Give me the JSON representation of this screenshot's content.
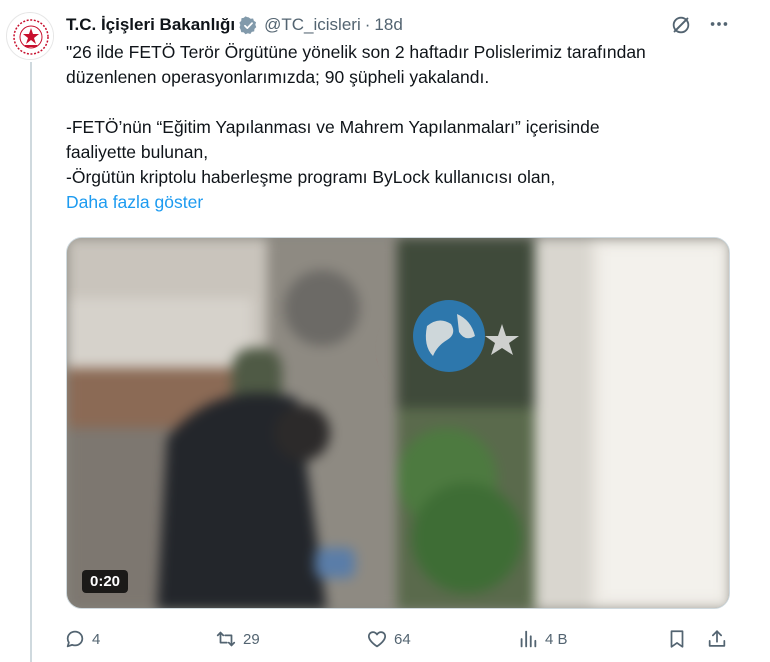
{
  "author": {
    "display_name": "T.C. İçişleri Bakanlığı",
    "handle": "@TC_icisleri",
    "separator": "·",
    "time": "18d"
  },
  "tweet": {
    "line1": "\"26 ilde FETÖ Terör Örgütüne yönelik son 2 haftadır Polislerimiz tarafından",
    "line2": "düzenlenen operasyonlarımızda; 90 şüpheli yakalandı.",
    "line3": "-FETÖ’nün “Eğitim Yapılanması ve Mahrem Yapılanmaları” içerisinde",
    "line4": "faaliyette bulunan,",
    "line5": "-Örgütün kriptolu haberleşme programı ByLock kullanıcısı olan,",
    "show_more": "Daha fazla göster"
  },
  "media": {
    "duration": "0:20"
  },
  "actions": {
    "replies": "4",
    "reposts": "29",
    "likes": "64",
    "views": "4 B"
  },
  "icons": {
    "avatar": "ministry-emblem-icon",
    "verified": "verified-badge-icon",
    "grok": "grok-icon",
    "more": "more-icon",
    "reply": "reply-icon",
    "repost": "repost-icon",
    "like": "heart-icon",
    "views": "views-icon",
    "bookmark": "bookmark-icon",
    "share": "share-icon"
  },
  "colors": {
    "accent": "#1d9bf0",
    "muted": "#536471",
    "verified_gray": "#829aab",
    "emblem_red": "#c8102e"
  }
}
